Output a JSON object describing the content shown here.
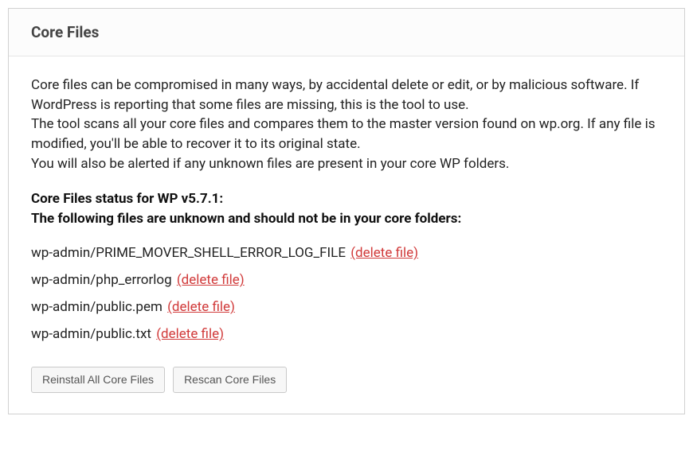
{
  "panel": {
    "title": "Core Files",
    "description_l1": "Core files can be compromised in many ways, by accidental delete or edit, or by malicious software. If WordPress is reporting that some files are missing, this is the tool to use.",
    "description_l2": "The tool scans all your core files and compares them to the master version found on wp.org. If any file is modified, you'll be able to recover it to its original state.",
    "description_l3": "You will also be alerted if any unknown files are present in your core WP folders.",
    "status_line1": "Core Files status for WP v5.7.1:",
    "status_line2": "The following files are unknown and should not be in your core folders:",
    "files": [
      {
        "path": "wp-admin/PRIME_MOVER_SHELL_ERROR_LOG_FILE",
        "action_label": "(delete file)"
      },
      {
        "path": "wp-admin/php_errorlog",
        "action_label": "(delete file)"
      },
      {
        "path": "wp-admin/public.pem",
        "action_label": "(delete file)"
      },
      {
        "path": "wp-admin/public.txt",
        "action_label": "(delete file)"
      }
    ],
    "buttons": {
      "reinstall": "Reinstall All Core Files",
      "rescan": "Rescan Core Files"
    }
  }
}
